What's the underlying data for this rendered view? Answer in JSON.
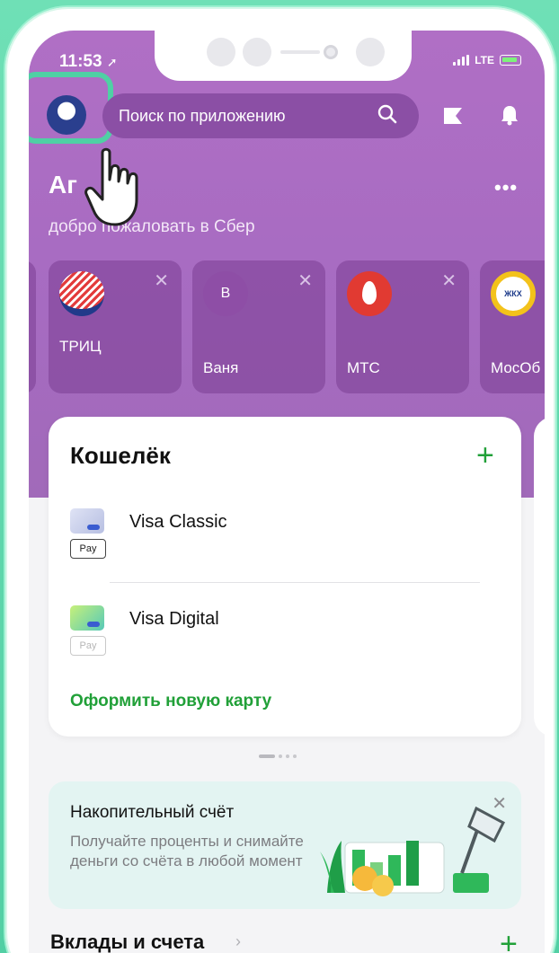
{
  "status_bar": {
    "time": "11:53",
    "network": "LTE"
  },
  "header": {
    "search_placeholder": "Поиск по приложению",
    "user_name": "Аг",
    "welcome": "добро пожаловать в Сбер",
    "more_label": "•••"
  },
  "quick_payments": [
    {
      "label": "ТРИЦ",
      "logo": "trits-logo"
    },
    {
      "label": "Ваня",
      "logo": "avatar-letter",
      "initial": "В"
    },
    {
      "label": "МТС",
      "logo": "mts-logo"
    },
    {
      "label": "МосОб",
      "logo": "zhkh-logo",
      "logo_text": "ЖКХ"
    }
  ],
  "wallet": {
    "title": "Кошелёк",
    "cards": [
      {
        "name": "Visa Classic",
        "pay_label": "Pay",
        "pay_active": true
      },
      {
        "name": "Visa Digital",
        "pay_label": "Pay",
        "pay_active": false
      }
    ],
    "new_card_label": "Оформить новую карту"
  },
  "savings_promo": {
    "title": "Накопительный счёт",
    "text": "Получайте проценты и снимайте деньги со счёта в любой момент",
    "close": "✕"
  },
  "deposits": {
    "title": "Вклады и счета"
  },
  "colors": {
    "brand_purple": "#a66bc1",
    "accent_green": "#21a038",
    "highlight": "#4fd0a4"
  }
}
